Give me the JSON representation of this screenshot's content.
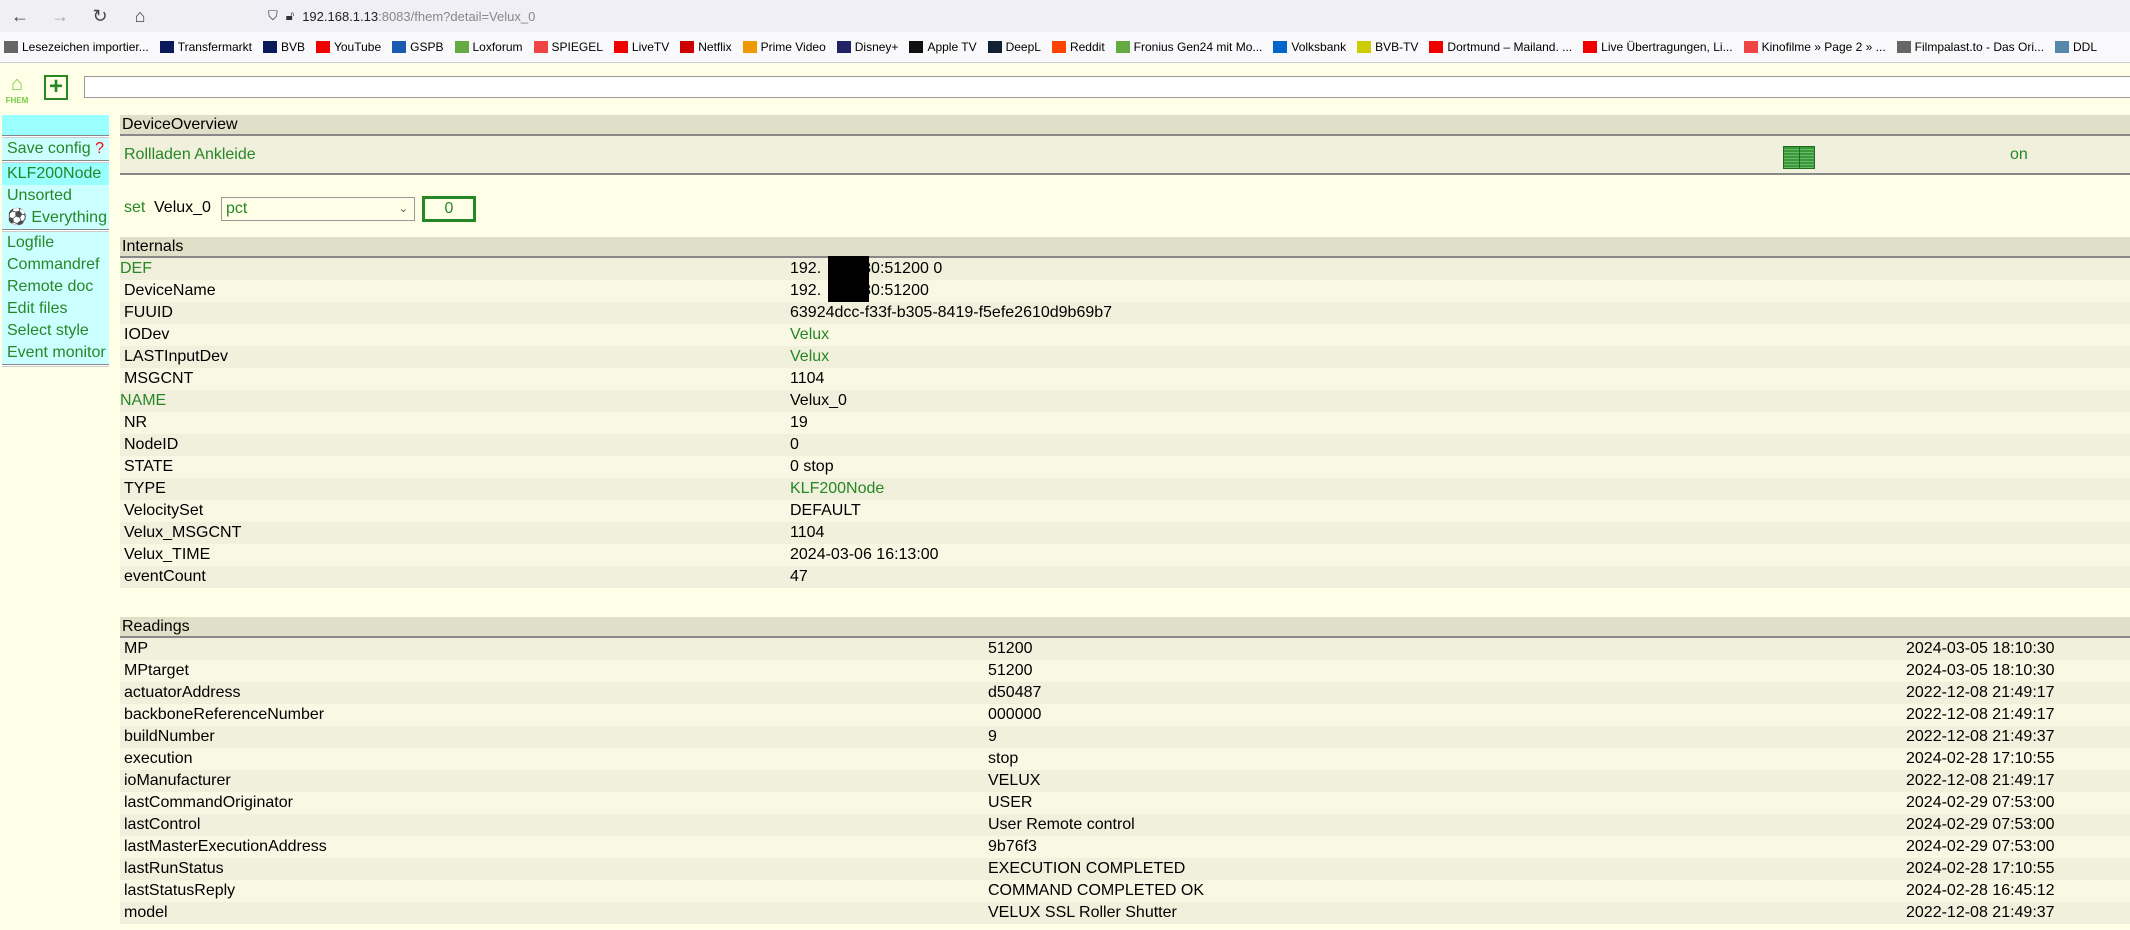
{
  "browser": {
    "url_host": "192.168.1.13",
    "url_rest": ":8083/fhem?detail=Velux_0",
    "bookmarks": [
      "Lesezeichen importier...",
      "Transfermarkt",
      "BVB",
      "YouTube",
      "GSPB",
      "Loxforum",
      "SPIEGEL",
      "LiveTV",
      "Netflix",
      "Prime Video",
      "Disney+",
      "Apple TV",
      "DeepL",
      "Reddit",
      "Fronius Gen24 mit Mo...",
      "Volksbank",
      "BVB-TV",
      "Dortmund – Mailand. ...",
      "Live Übertragungen, Li...",
      "Kinofilme » Page 2 » ...",
      "Filmpalast.to - Das Ori...",
      "DDL"
    ]
  },
  "header": {
    "logo_text": "FHEM",
    "command_value": ""
  },
  "sidebar": {
    "save_config": "Save config",
    "save_q": "?",
    "rooms": [
      "KLF200Node",
      "Unsorted",
      "Everything"
    ],
    "links": [
      "Logfile",
      "Commandref",
      "Remote doc",
      "Edit files",
      "Select style",
      "Event monitor"
    ]
  },
  "overview": {
    "title": "DeviceOverview",
    "alias": "Rollladen Ankleide",
    "state": "on",
    "state_icon": "shutter-icon"
  },
  "set": {
    "label": "set",
    "device": "Velux_0",
    "selected": "pct",
    "value": "0"
  },
  "internals": {
    "title": "Internals",
    "rows": [
      {
        "k": "DEF",
        "v": "192.",
        "v2": "30:51200 0",
        "kg": true
      },
      {
        "k": "DeviceName",
        "v": "192.",
        "v2": "30:51200"
      },
      {
        "k": "FUUID",
        "v": "63924dcc-f33f-b305-8419-f5efe2610d9b69b7"
      },
      {
        "k": "IODev",
        "v": "Velux",
        "vg": true
      },
      {
        "k": "LASTInputDev",
        "v": "Velux",
        "vg": true
      },
      {
        "k": "MSGCNT",
        "v": "1104"
      },
      {
        "k": "NAME",
        "v": "Velux_0",
        "kg": true
      },
      {
        "k": "NR",
        "v": "19"
      },
      {
        "k": "NodeID",
        "v": "0"
      },
      {
        "k": "STATE",
        "v": "0 stop"
      },
      {
        "k": "TYPE",
        "v": "KLF200Node",
        "vg": true
      },
      {
        "k": "VelocitySet",
        "v": "DEFAULT"
      },
      {
        "k": "Velux_MSGCNT",
        "v": "1104"
      },
      {
        "k": "Velux_TIME",
        "v": "2024-03-06 16:13:00"
      },
      {
        "k": "eventCount",
        "v": "47"
      }
    ]
  },
  "readings": {
    "title": "Readings",
    "rows": [
      {
        "k": "MP",
        "v": "51200",
        "t": "2024-03-05 18:10:30"
      },
      {
        "k": "MPtarget",
        "v": "51200",
        "t": "2024-03-05 18:10:30"
      },
      {
        "k": "actuatorAddress",
        "v": "d50487",
        "t": "2022-12-08 21:49:17"
      },
      {
        "k": "backboneReferenceNumber",
        "v": "000000",
        "t": "2022-12-08 21:49:17"
      },
      {
        "k": "buildNumber",
        "v": "9",
        "t": "2022-12-08 21:49:37"
      },
      {
        "k": "execution",
        "v": "stop",
        "t": "2024-02-28 17:10:55"
      },
      {
        "k": "ioManufacturer",
        "v": "VELUX",
        "t": "2022-12-08 21:49:17"
      },
      {
        "k": "lastCommandOriginator",
        "v": "USER",
        "t": "2024-02-29 07:53:00"
      },
      {
        "k": "lastControl",
        "v": "User Remote control",
        "t": "2024-02-29 07:53:00"
      },
      {
        "k": "lastMasterExecutionAddress",
        "v": "9b76f3",
        "t": "2024-02-29 07:53:00"
      },
      {
        "k": "lastRunStatus",
        "v": "EXECUTION COMPLETED",
        "t": "2024-02-28 17:10:55"
      },
      {
        "k": "lastStatusReply",
        "v": "COMMAND COMPLETED OK",
        "t": "2024-02-28 16:45:12"
      },
      {
        "k": "model",
        "v": "VELUX SSL Roller Shutter",
        "t": "2022-12-08 21:49:37"
      }
    ]
  }
}
